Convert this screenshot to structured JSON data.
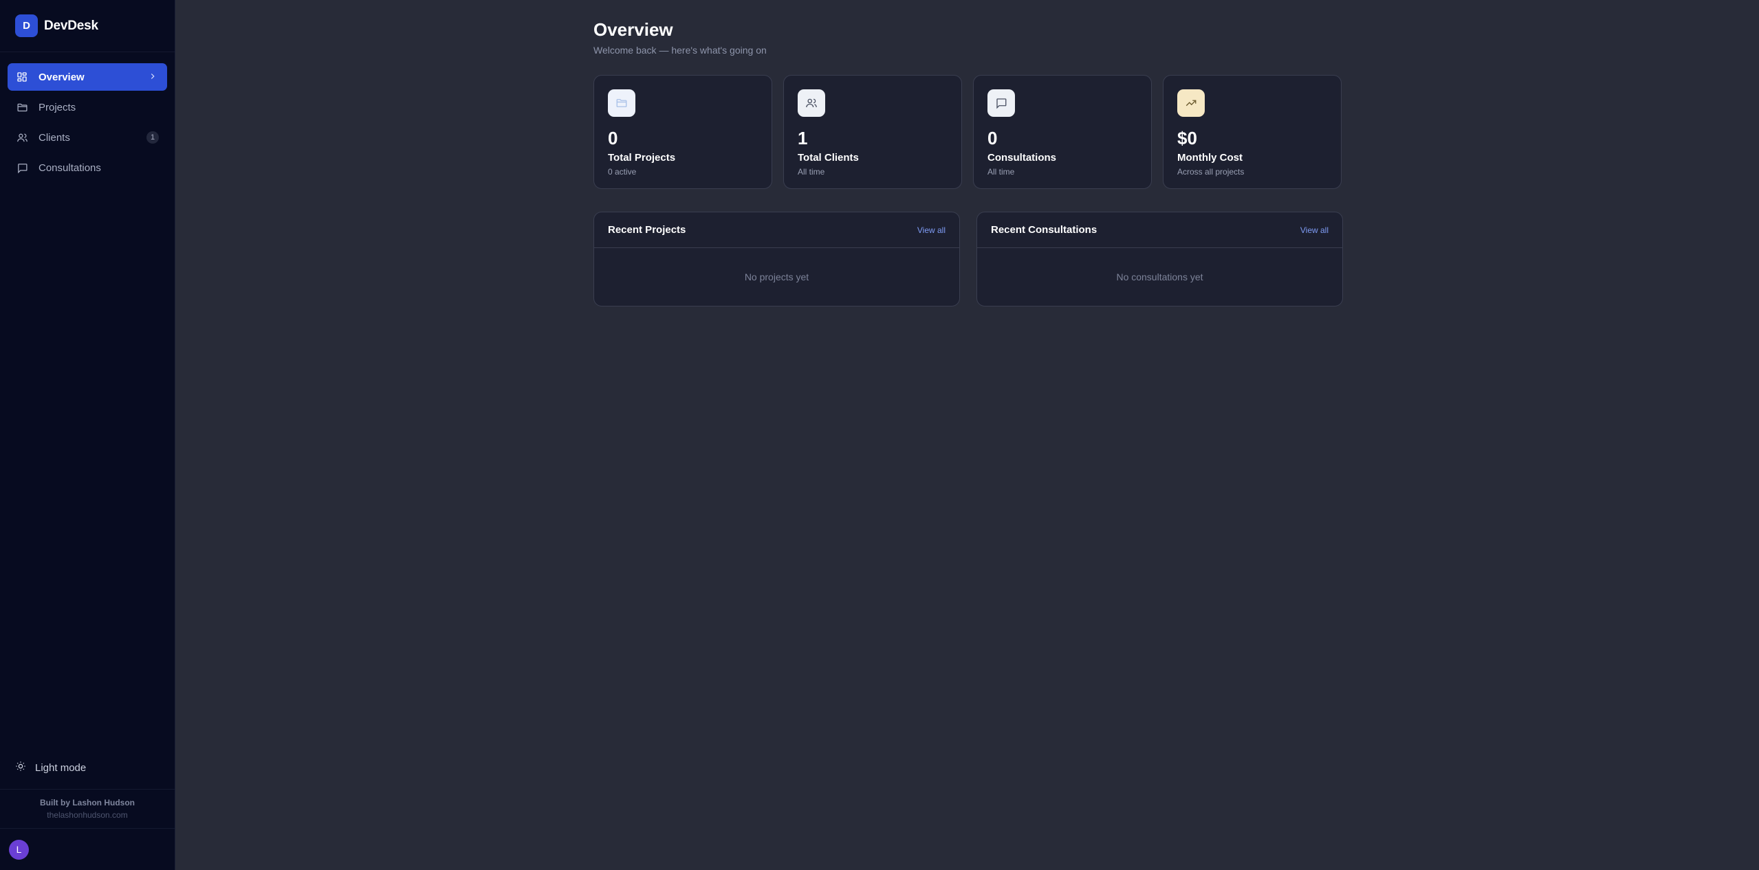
{
  "brand": {
    "initial": "D",
    "name": "DevDesk"
  },
  "nav": {
    "items": [
      {
        "label": "Overview",
        "icon": "dashboard-icon",
        "active": true
      },
      {
        "label": "Projects",
        "icon": "folder-icon"
      },
      {
        "label": "Clients",
        "icon": "users-icon",
        "badge": "1"
      },
      {
        "label": "Consultations",
        "icon": "message-icon"
      }
    ]
  },
  "theme_toggle": {
    "label": "Light mode",
    "icon": "sun-icon"
  },
  "credit": {
    "name": "Built by Lashon Hudson",
    "site": "thelashonhudson.com"
  },
  "user": {
    "initial": "L"
  },
  "page": {
    "title": "Overview",
    "subtitle": "Welcome back — here's what's going on"
  },
  "stats": [
    {
      "value": "0",
      "label": "Total Projects",
      "sub": "0 active",
      "icon": "folder-icon",
      "icon_bg": "#eef2fb"
    },
    {
      "value": "1",
      "label": "Total Clients",
      "sub": "All time",
      "icon": "users-icon",
      "icon_bg": "#eef1f6"
    },
    {
      "value": "0",
      "label": "Consultations",
      "sub": "All time",
      "icon": "message-icon",
      "icon_bg": "#eef1f6"
    },
    {
      "value": "$0",
      "label": "Monthly Cost",
      "sub": "Across all projects",
      "icon": "trending-up-icon",
      "icon_bg": "#f6e8c4"
    }
  ],
  "panels": [
    {
      "title": "Recent Projects",
      "link": "View all",
      "empty": "No projects yet"
    },
    {
      "title": "Recent Consultations",
      "link": "View all",
      "empty": "No consultations yet"
    }
  ],
  "colors": {
    "accent": "#2d4fd6",
    "sidebar_bg": "#070b20",
    "main_bg": "#282b38",
    "card_bg": "#1d2030",
    "link": "#7f9cf5",
    "avatar": "#6a3fd4"
  }
}
